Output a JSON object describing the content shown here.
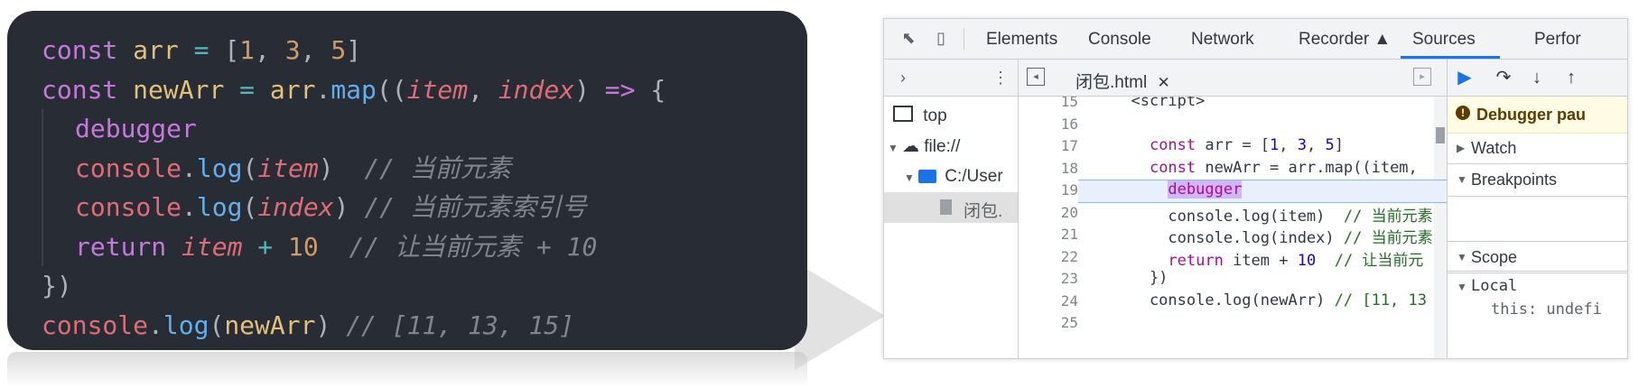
{
  "code_card": {
    "lines": [
      {
        "tokens": [
          {
            "t": "const ",
            "c": "kw"
          },
          {
            "t": "arr",
            "c": "var"
          },
          {
            "t": " = ",
            "c": "op"
          },
          {
            "t": "[",
            "c": "pl"
          },
          {
            "t": "1",
            "c": "num"
          },
          {
            "t": ", ",
            "c": "pl"
          },
          {
            "t": "3",
            "c": "num"
          },
          {
            "t": ", ",
            "c": "pl"
          },
          {
            "t": "5",
            "c": "num"
          },
          {
            "t": "]",
            "c": "pl"
          }
        ],
        "indent": false
      },
      {
        "tokens": [
          {
            "t": "const ",
            "c": "kw"
          },
          {
            "t": "newArr",
            "c": "var"
          },
          {
            "t": " = ",
            "c": "op"
          },
          {
            "t": "arr",
            "c": "nm"
          },
          {
            "t": ".",
            "c": "pl"
          },
          {
            "t": "map",
            "c": "fn"
          },
          {
            "t": "((",
            "c": "pl"
          },
          {
            "t": "item",
            "c": "param"
          },
          {
            "t": ", ",
            "c": "pl"
          },
          {
            "t": "index",
            "c": "param"
          },
          {
            "t": ") ",
            "c": "pl"
          },
          {
            "t": "=>",
            "c": "kw"
          },
          {
            "t": " {",
            "c": "pl"
          }
        ],
        "indent": false
      },
      {
        "tokens": [
          {
            "t": "debugger",
            "c": "kw"
          }
        ],
        "indent": true
      },
      {
        "tokens": [
          {
            "t": "console",
            "c": "vio"
          },
          {
            "t": ".",
            "c": "pl"
          },
          {
            "t": "log",
            "c": "fn"
          },
          {
            "t": "(",
            "c": "pl"
          },
          {
            "t": "item",
            "c": "param"
          },
          {
            "t": ")  ",
            "c": "pl"
          },
          {
            "t": "// 当前元素",
            "c": "cm"
          }
        ],
        "indent": true
      },
      {
        "tokens": [
          {
            "t": "console",
            "c": "vio"
          },
          {
            "t": ".",
            "c": "pl"
          },
          {
            "t": "log",
            "c": "fn"
          },
          {
            "t": "(",
            "c": "pl"
          },
          {
            "t": "index",
            "c": "param"
          },
          {
            "t": ") ",
            "c": "pl"
          },
          {
            "t": "// 当前元素索引号",
            "c": "cm"
          }
        ],
        "indent": true
      },
      {
        "tokens": [
          {
            "t": "return ",
            "c": "kw"
          },
          {
            "t": "item",
            "c": "param"
          },
          {
            "t": " + ",
            "c": "op"
          },
          {
            "t": "10",
            "c": "num"
          },
          {
            "t": "  ",
            "c": "pl"
          },
          {
            "t": "// 让当前元素 + 10",
            "c": "cm"
          }
        ],
        "indent": true
      },
      {
        "tokens": [
          {
            "t": "})",
            "c": "pl"
          }
        ],
        "indent": false
      },
      {
        "tokens": [
          {
            "t": "console",
            "c": "vio"
          },
          {
            "t": ".",
            "c": "pl"
          },
          {
            "t": "log",
            "c": "fn"
          },
          {
            "t": "(",
            "c": "pl"
          },
          {
            "t": "newArr",
            "c": "nm"
          },
          {
            "t": ") ",
            "c": "pl"
          },
          {
            "t": "// [11, 13, 15]",
            "c": "cm"
          }
        ],
        "indent": false
      }
    ]
  },
  "devtools": {
    "tabs": [
      "Elements",
      "Console",
      "Network",
      "Recorder ▲",
      "Sources",
      "Perfor"
    ],
    "active_tab": "Sources",
    "file_tab": "闭包.html",
    "nav": {
      "top": "top",
      "origin": "file://",
      "folder": "C:/User",
      "file": "闭包."
    },
    "editor_lines": [
      {
        "num": "15",
        "html": "  &lt;script&gt;"
      },
      {
        "num": "16",
        "html": ""
      },
      {
        "num": "17",
        "html": "    <span class='d-kw'>const</span> arr = [<span class='d-num'>1</span>, <span class='d-num'>3</span>, <span class='d-num'>5</span>]"
      },
      {
        "num": "18",
        "html": "    <span class='d-kw'>const</span> newArr = arr.map((item,"
      },
      {
        "num": "19",
        "html": "      <span class='d-kw dbg-mark'>debugger</span>"
      },
      {
        "num": "20",
        "html": "      console.log(item)  <span class='d-cm'>// 当前元素</span>"
      },
      {
        "num": "21",
        "html": "      console.log(index) <span class='d-cm'>// 当前元素</span>"
      },
      {
        "num": "22",
        "html": "      <span class='d-kw'>return</span> item + <span class='d-num'>10</span>  <span class='d-cm'>// 让当前元</span>"
      },
      {
        "num": "23",
        "html": "    })"
      },
      {
        "num": "24",
        "html": "    console.log(newArr) <span class='d-cm'>// [11, 13</span>"
      },
      {
        "num": "25",
        "html": ""
      }
    ],
    "right": {
      "paused": "Debugger pau",
      "watch": "Watch",
      "breakpoints": "Breakpoints",
      "scope": "Scope",
      "local": "Local",
      "this_line": "this: undefi"
    },
    "colors": {
      "accent": "#1a73e8",
      "paused_bg": "#fffbe5"
    }
  }
}
